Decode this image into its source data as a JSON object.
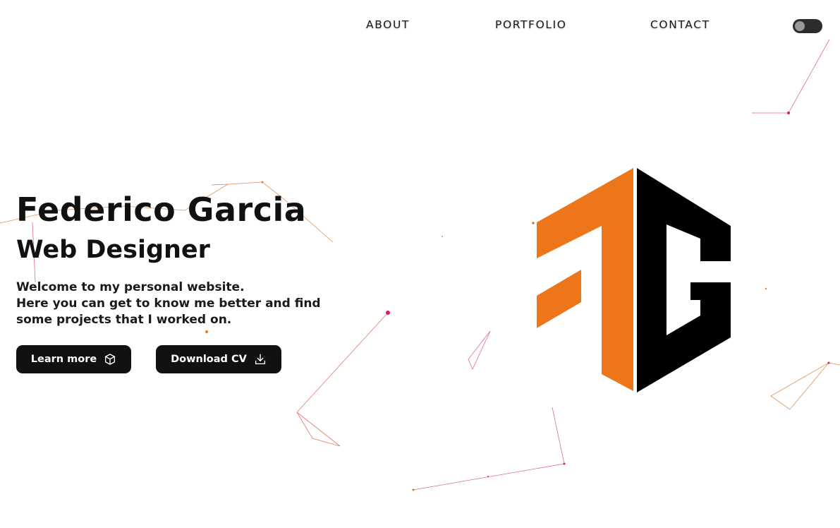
{
  "nav": {
    "about_label": "ABOUT",
    "portfolio_label": "PORTFOLIO",
    "contact_label": "CONTACT"
  },
  "theme_toggle": {
    "state": "off"
  },
  "hero": {
    "name": "Federico Garcia",
    "role": "Web Designer",
    "intro_line1": "Welcome to my personal website.",
    "intro_line2": "Here you can get to know me better and find some projects that I worked on."
  },
  "buttons": {
    "learn_more_label": "Learn more",
    "learn_more_icon": "cube-icon",
    "download_cv_label": "Download CV",
    "download_cv_icon": "download-icon"
  },
  "logo": {
    "icon": "fg-monogram-logo",
    "left_color": "#EC7619",
    "right_color": "#000000"
  },
  "colors": {
    "accent_orange": "#EC7619",
    "accent_pink": "#E0186C",
    "button_bg": "#111111",
    "text": "#111111"
  }
}
